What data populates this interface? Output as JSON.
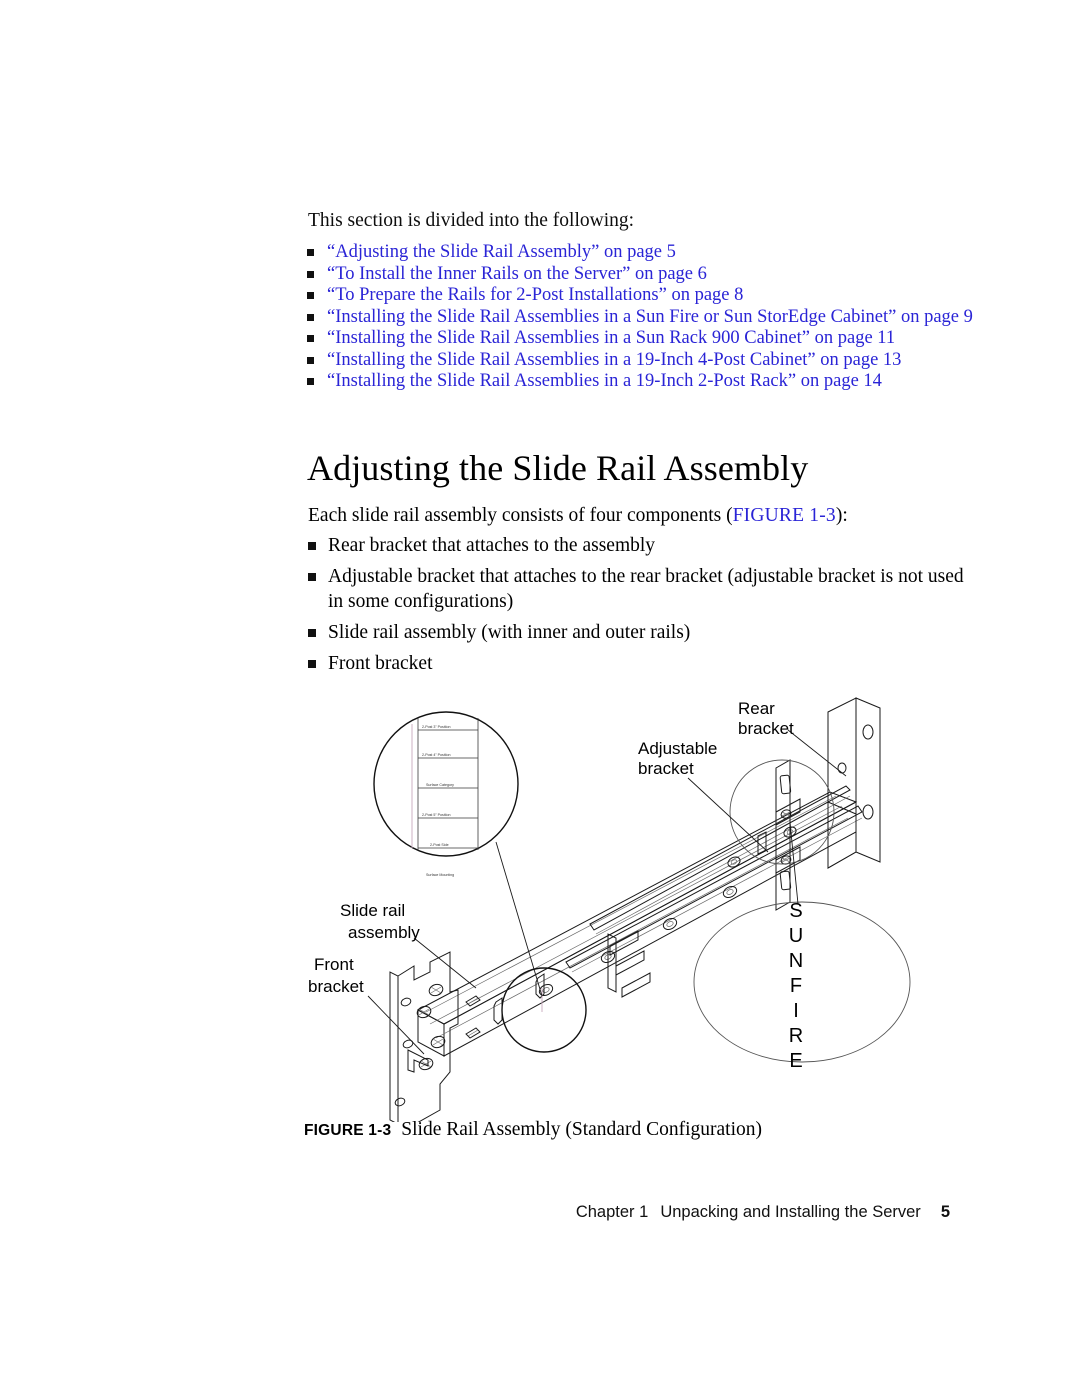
{
  "page": {
    "intro_text": "This section is divided into the following:",
    "section_heading": "Adjusting the Slide Rail Assembly",
    "lead_prefix": "Each slide rail assembly consists of four components (",
    "lead_figure_ref": "FIGURE 1-3",
    "lead_suffix": "):",
    "link_color": "#2a24d6"
  },
  "cross_references": [
    {
      "label": "“Adjusting the Slide Rail Assembly” on page 5"
    },
    {
      "label": "“To Install the Inner Rails on the Server” on page 6"
    },
    {
      "label": "“To Prepare the Rails for 2-Post Installations” on page 8"
    },
    {
      "label": "“Installing the Slide Rail Assemblies in a Sun Fire or Sun StorEdge Cabinet” on page 9"
    },
    {
      "label": "“Installing the Slide Rail Assemblies in a Sun Rack 900 Cabinet” on page 11"
    },
    {
      "label": "“Installing the Slide Rail Assemblies in a 19-Inch 4-Post Cabinet” on page 13"
    },
    {
      "label": "“Installing the Slide Rail Assemblies in a 19-Inch 2-Post Rack” on page 14"
    }
  ],
  "components": [
    {
      "label": "Rear bracket that attaches to the assembly"
    },
    {
      "label": "Adjustable bracket that attaches to the rear bracket (adjustable bracket is not used in some configurations)"
    },
    {
      "label": "Slide rail assembly (with inner and outer rails)"
    },
    {
      "label": "Front bracket"
    }
  ],
  "figure": {
    "callouts": {
      "rear_bracket_line1": "Rear",
      "rear_bracket_line2": "bracket",
      "adjustable_bracket_line1": "Adjustable",
      "adjustable_bracket_line2": "bracket",
      "slide_rail_line1": "Slide rail",
      "slide_rail_line2": "assembly",
      "front_bracket_line1": "Front",
      "front_bracket_line2": "bracket"
    },
    "sunfire_letters": [
      "S",
      "U",
      "N",
      "F",
      "I",
      "R",
      "E"
    ],
    "detail_labels": [
      "2-Post 3\" Position",
      "2-Post 4\" Position",
      "Surface Category",
      "2-Post 5\" Position",
      "2-Post Side",
      "Surface Mounting"
    ],
    "caption_tag": "FIGURE 1-3",
    "caption_text": "Slide Rail Assembly (Standard Configuration)"
  },
  "footer": {
    "chapter": "Chapter 1",
    "title": "Unpacking and Installing the Server",
    "page_number": "5"
  }
}
